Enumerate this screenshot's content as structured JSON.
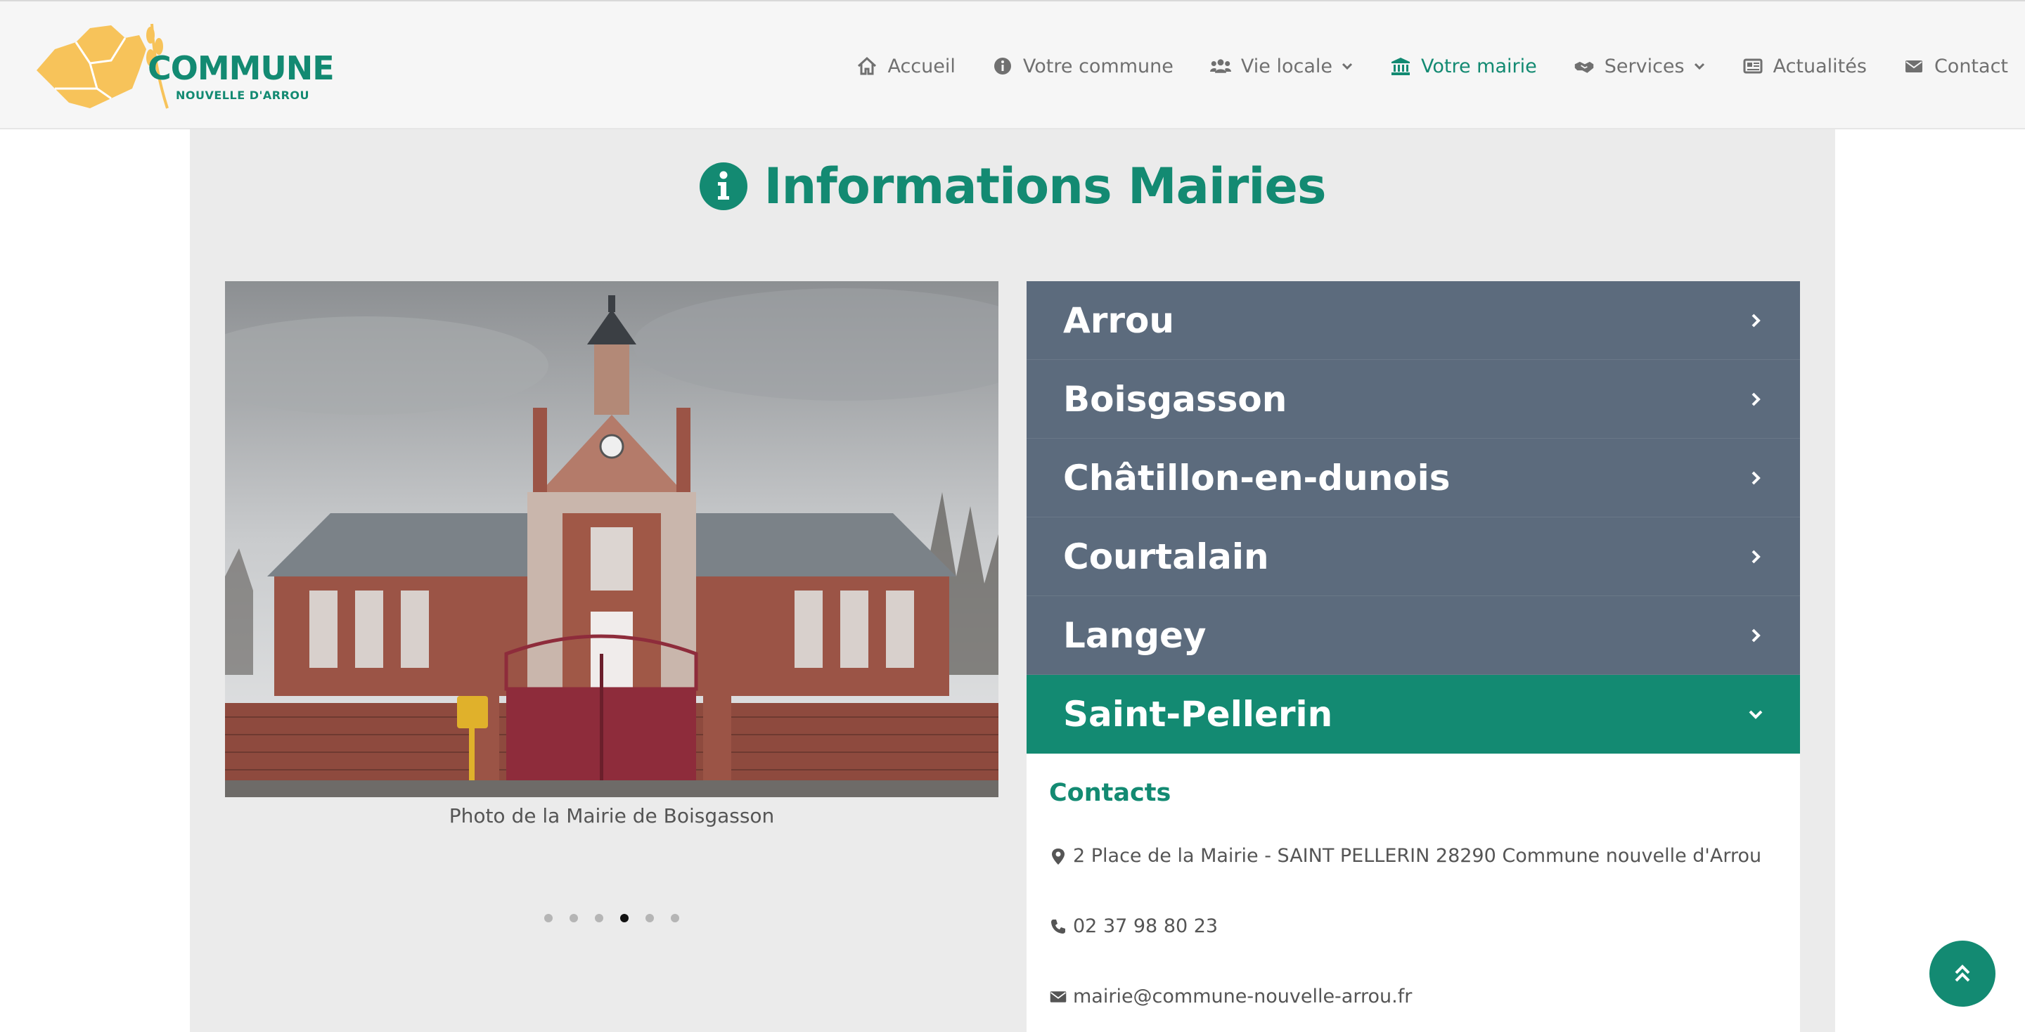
{
  "brand": {
    "name": "COMMUNE",
    "subtitle": "NOUVELLE D'ARROU",
    "logo_color": "#f7c35a",
    "accent_color": "#138a72"
  },
  "nav": {
    "items": [
      {
        "label": "Accueil",
        "icon": "home-icon"
      },
      {
        "label": "Votre commune",
        "icon": "info-icon"
      },
      {
        "label": "Vie locale",
        "icon": "users-icon",
        "dropdown": true
      },
      {
        "label": "Votre mairie",
        "icon": "town-hall-icon",
        "active": true
      },
      {
        "label": "Services",
        "icon": "handshake-icon",
        "dropdown": true
      },
      {
        "label": "Actualités",
        "icon": "newspaper-icon"
      },
      {
        "label": "Contact",
        "icon": "envelope-icon"
      }
    ]
  },
  "page": {
    "title": "Informations Mairies"
  },
  "carousel": {
    "caption": "Photo de la Mairie de Boisgasson",
    "slide_count": 6,
    "active_slide": 4
  },
  "accordion": {
    "items": [
      {
        "label": "Arrou"
      },
      {
        "label": "Boisgasson"
      },
      {
        "label": "Châtillon-en-dunois"
      },
      {
        "label": "Courtalain"
      },
      {
        "label": "Langey"
      },
      {
        "label": "Saint-Pellerin",
        "open": true
      }
    ],
    "panel": {
      "title": "Contacts",
      "address": "2 Place de la Mairie - SAINT PELLERIN 28290 Commune nouvelle d'Arrou",
      "phone": "02 37 98 80 23",
      "email": "mairie@commune-nouvelle-arrou.fr"
    }
  }
}
